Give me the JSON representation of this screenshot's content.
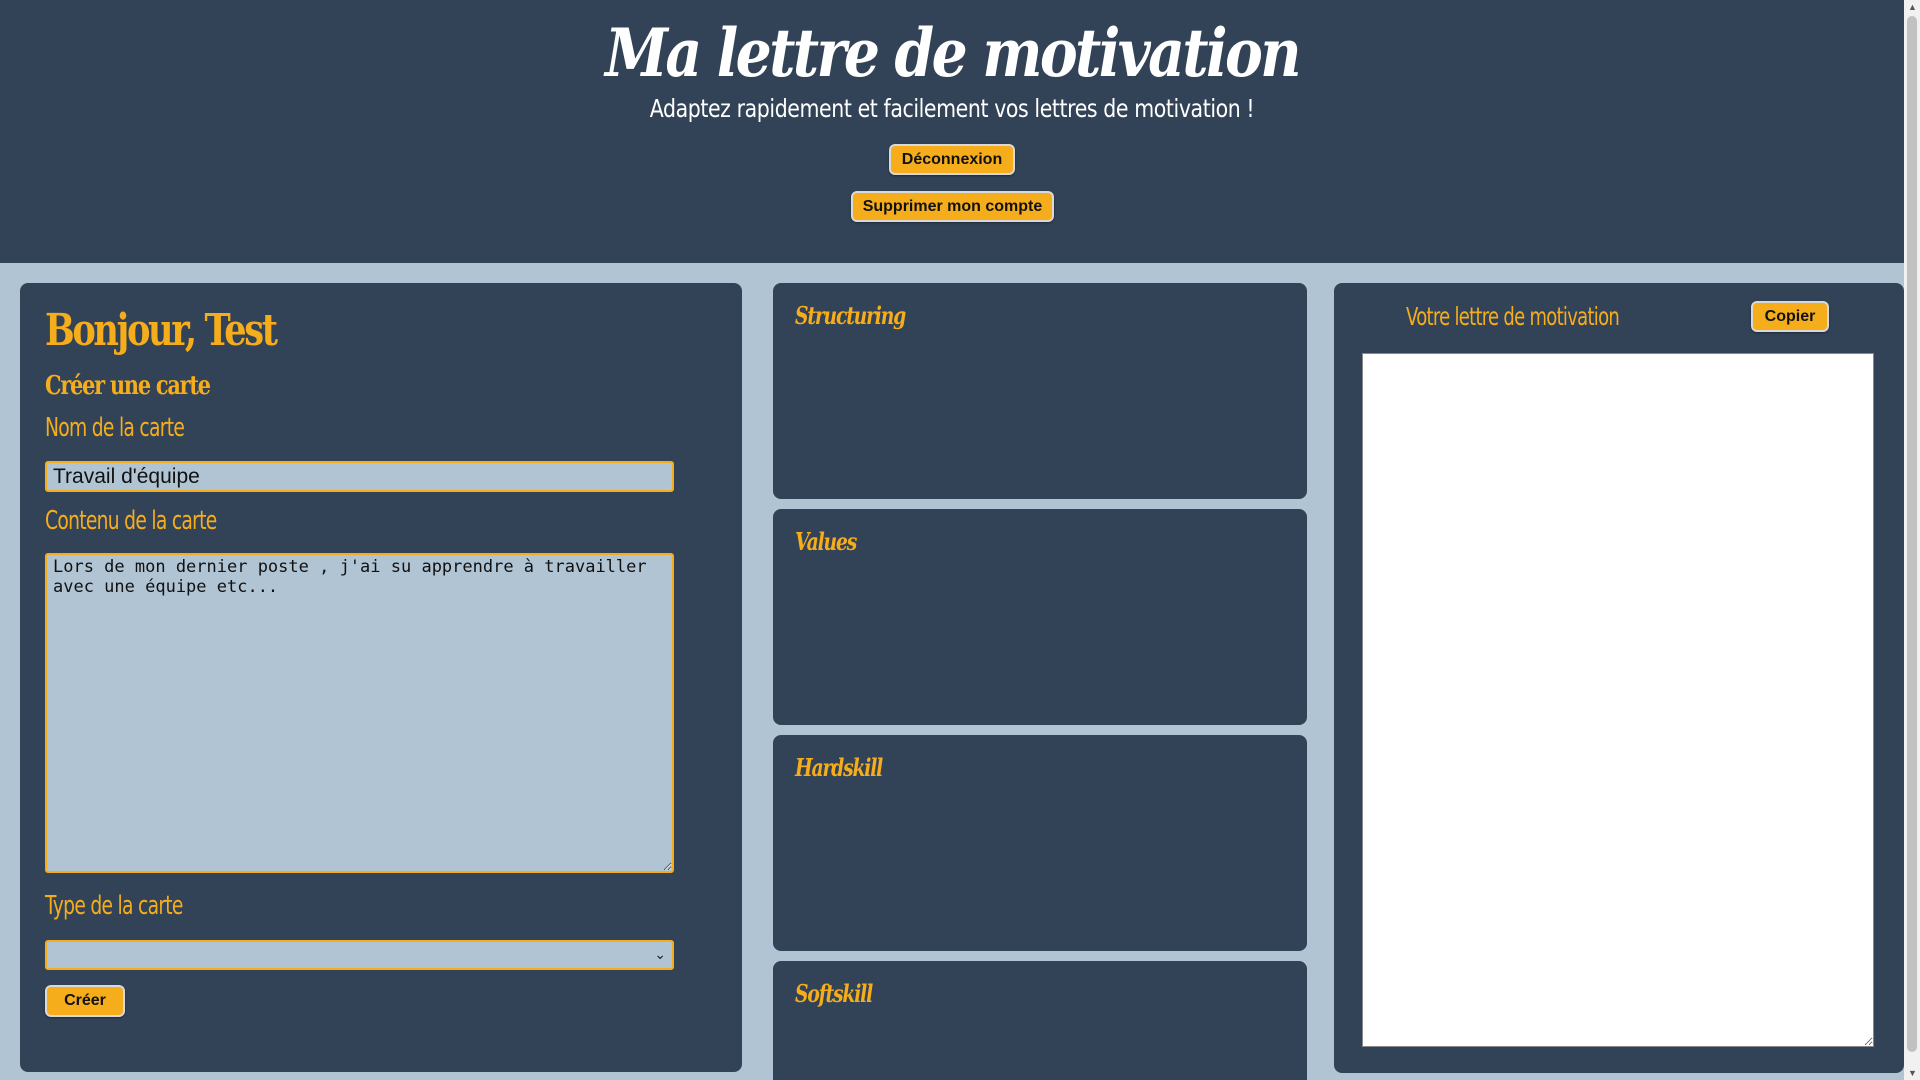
{
  "header": {
    "title": "Ma lettre de motivation",
    "subtitle": "Adaptez rapidement et facilement vos lettres de motivation !",
    "logout_label": "Déconnexion",
    "delete_account_label": "Supprimer mon compte"
  },
  "create_panel": {
    "greeting": "Bonjour, Test",
    "section_title": "Créer une carte",
    "name_label": "Nom de la carte",
    "name_value": "Travail d'équipe",
    "content_label": "Contenu de la carte",
    "content_value": "Lors de mon dernier poste , j'ai su apprendre à travailler avec une équipe etc...",
    "type_label": "Type de la carte",
    "type_value": "",
    "create_label": "Créer"
  },
  "cards": {
    "structuring": "Structuring",
    "values": "Values",
    "hardskill": "Hardskill",
    "softskill": "Softskill"
  },
  "letter_panel": {
    "title": "Votre lettre de motivation",
    "copy_label": "Copier",
    "content": ""
  },
  "colors": {
    "primary_bg": "#334357",
    "page_bg": "#b0c4d4",
    "accent": "#f5ad1c"
  }
}
